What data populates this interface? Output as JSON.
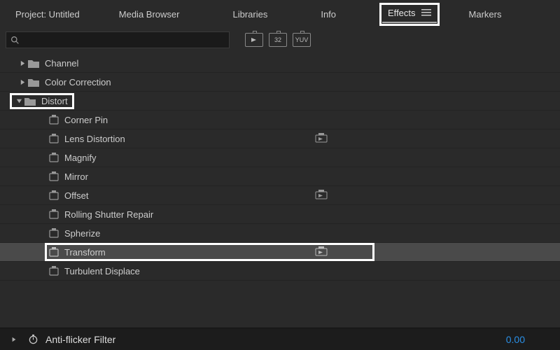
{
  "tabs": {
    "project": "Project: Untitled",
    "media": "Media Browser",
    "libraries": "Libraries",
    "info": "Info",
    "effects": "Effects",
    "markers": "Markers"
  },
  "search": {
    "placeholder": ""
  },
  "filters": {
    "fx": "▶",
    "thirtytwo": "32",
    "yuv": "YUV"
  },
  "tree": {
    "folders": [
      {
        "label": "Channel",
        "expanded": false
      },
      {
        "label": "Color Correction",
        "expanded": false
      },
      {
        "label": "Distort",
        "expanded": true,
        "highlighted": true
      }
    ],
    "distortItems": [
      {
        "label": "Corner Pin",
        "accel": false,
        "selected": false
      },
      {
        "label": "Lens Distortion",
        "accel": true,
        "selected": false
      },
      {
        "label": "Magnify",
        "accel": false,
        "selected": false
      },
      {
        "label": "Mirror",
        "accel": false,
        "selected": false
      },
      {
        "label": "Offset",
        "accel": true,
        "selected": false
      },
      {
        "label": "Rolling Shutter Repair",
        "accel": false,
        "selected": false
      },
      {
        "label": "Spherize",
        "accel": false,
        "selected": false
      },
      {
        "label": "Transform",
        "accel": true,
        "selected": true,
        "highlighted": true
      },
      {
        "label": "Turbulent Displace",
        "accel": false,
        "selected": false
      }
    ]
  },
  "bottom": {
    "label": "Anti-flicker Filter",
    "value": "0.00"
  }
}
